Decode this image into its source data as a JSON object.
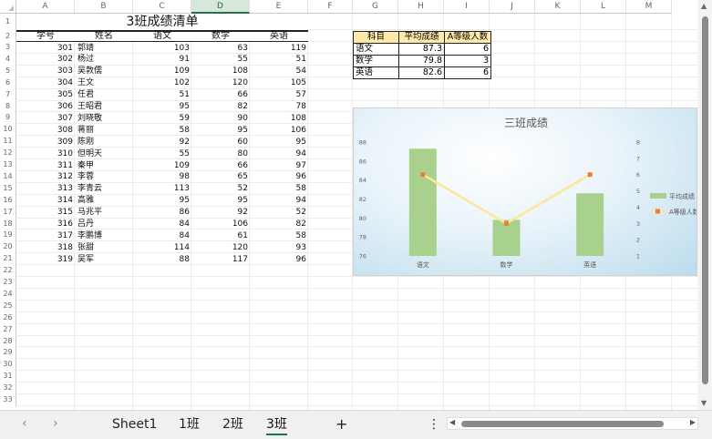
{
  "columns": [
    "A",
    "B",
    "C",
    "D",
    "E",
    "F",
    "G",
    "H",
    "I",
    "J",
    "K",
    "L",
    "M"
  ],
  "rows": [
    "1",
    "2",
    "3",
    "4",
    "5",
    "6",
    "7",
    "8",
    "9",
    "10",
    "11",
    "12",
    "13",
    "14",
    "15",
    "16",
    "17",
    "18",
    "19",
    "20",
    "21",
    "22",
    "23",
    "24",
    "25",
    "26",
    "27",
    "28",
    "29",
    "30",
    "31",
    "32",
    "33"
  ],
  "sheet_title": "3班成绩清单",
  "table_headers": [
    "学号",
    "姓名",
    "语文",
    "数学",
    "英语"
  ],
  "students": [
    {
      "id": "301",
      "name": "郭靖",
      "chinese": "103",
      "math": "63",
      "english": "119"
    },
    {
      "id": "302",
      "name": "杨过",
      "chinese": "91",
      "math": "55",
      "english": "51"
    },
    {
      "id": "303",
      "name": "吴敦儒",
      "chinese": "109",
      "math": "108",
      "english": "54"
    },
    {
      "id": "304",
      "name": "王文",
      "chinese": "102",
      "math": "120",
      "english": "105"
    },
    {
      "id": "305",
      "name": "任君",
      "chinese": "51",
      "math": "66",
      "english": "57"
    },
    {
      "id": "306",
      "name": "王昭君",
      "chinese": "95",
      "math": "82",
      "english": "78"
    },
    {
      "id": "307",
      "name": "刘晓敬",
      "chinese": "59",
      "math": "90",
      "english": "108"
    },
    {
      "id": "308",
      "name": "蒋丽",
      "chinese": "58",
      "math": "95",
      "english": "106"
    },
    {
      "id": "309",
      "name": "陈刚",
      "chinese": "92",
      "math": "60",
      "english": "95"
    },
    {
      "id": "310",
      "name": "但明天",
      "chinese": "55",
      "math": "80",
      "english": "94"
    },
    {
      "id": "311",
      "name": "秦甲",
      "chinese": "109",
      "math": "66",
      "english": "97"
    },
    {
      "id": "312",
      "name": "李蓉",
      "chinese": "98",
      "math": "65",
      "english": "96"
    },
    {
      "id": "313",
      "name": "李青云",
      "chinese": "113",
      "math": "52",
      "english": "58"
    },
    {
      "id": "314",
      "name": "高雅",
      "chinese": "95",
      "math": "95",
      "english": "94"
    },
    {
      "id": "315",
      "name": "马兆平",
      "chinese": "86",
      "math": "92",
      "english": "52"
    },
    {
      "id": "316",
      "name": "吕丹",
      "chinese": "84",
      "math": "106",
      "english": "82"
    },
    {
      "id": "317",
      "name": "李鹏博",
      "chinese": "84",
      "math": "61",
      "english": "58"
    },
    {
      "id": "318",
      "name": "张甜",
      "chinese": "114",
      "math": "120",
      "english": "93"
    },
    {
      "id": "319",
      "name": "吴军",
      "chinese": "88",
      "math": "117",
      "english": "96"
    }
  ],
  "stats": {
    "headers": [
      "科目",
      "平均成绩",
      "A等级人数"
    ],
    "rows": [
      {
        "subject": "语文",
        "avg": "87.3",
        "a_count": "6"
      },
      {
        "subject": "数学",
        "avg": "79.8",
        "a_count": "3"
      },
      {
        "subject": "英语",
        "avg": "82.6",
        "a_count": "6"
      }
    ]
  },
  "chart_data": {
    "type": "bar",
    "title": "三班成绩",
    "categories": [
      "语文",
      "数学",
      "英语"
    ],
    "series": [
      {
        "name": "平均成绩",
        "kind": "bar",
        "axis": "left",
        "values": [
          87.3,
          79.8,
          82.6
        ],
        "color": "#a9d18e"
      },
      {
        "name": "A等级人数",
        "kind": "line",
        "axis": "right",
        "values": [
          6,
          3,
          6
        ],
        "color": "#ed7d31",
        "line_color": "#ffe699"
      }
    ],
    "y_left_ticks": [
      "76",
      "78",
      "80",
      "82",
      "84",
      "86",
      "88"
    ],
    "ylim_left": [
      76,
      88
    ],
    "y_right_ticks": [
      "1",
      "2",
      "3",
      "4",
      "5",
      "6",
      "7",
      "8"
    ],
    "ylim_right": [
      1,
      8
    ],
    "legend": "right",
    "legend_labels": [
      "平均成绩",
      "A等级人数"
    ]
  },
  "tabs": {
    "prev": "‹",
    "next": "›",
    "items": [
      "Sheet1",
      "1班",
      "2班",
      "3班"
    ],
    "active": "3班",
    "add": "+",
    "more": "⋮"
  },
  "scroll": {
    "left": "◀",
    "right": "▶",
    "up": "▲",
    "down": "▼"
  }
}
